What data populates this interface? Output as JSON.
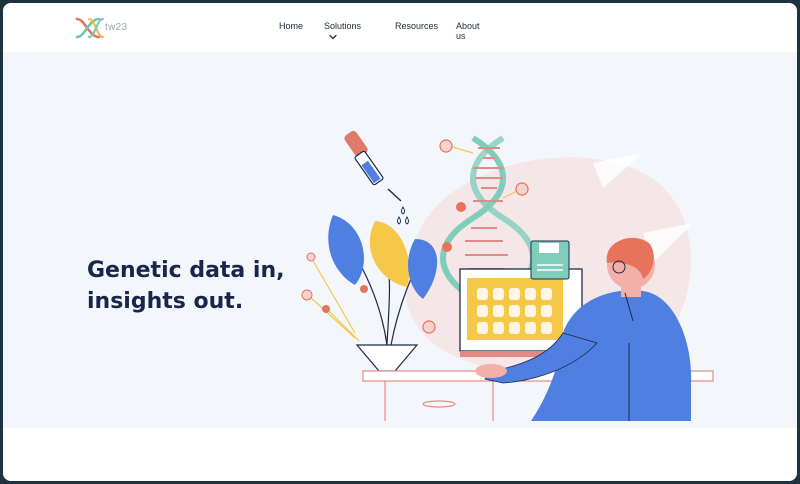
{
  "brand": {
    "name": "tw23",
    "logo_icon": "dna-helix-logo"
  },
  "nav": {
    "items": [
      {
        "label": "Home"
      },
      {
        "label": "Solutions",
        "icon": "chevron-down-icon"
      },
      {
        "label": "Resources"
      },
      {
        "label": "About us"
      }
    ]
  },
  "hero": {
    "headline_line1": "Genetic data in,",
    "headline_line2": "insights out.",
    "illustration": "scientist-at-computer-with-dna-illustration"
  },
  "colors": {
    "navy": "#17264a",
    "hero_bg": "#f3f7fb",
    "accent_pink": "#e48a86",
    "accent_blue": "#4f7fe0",
    "accent_yellow": "#f5c84a",
    "accent_teal": "#7fcdbb"
  }
}
